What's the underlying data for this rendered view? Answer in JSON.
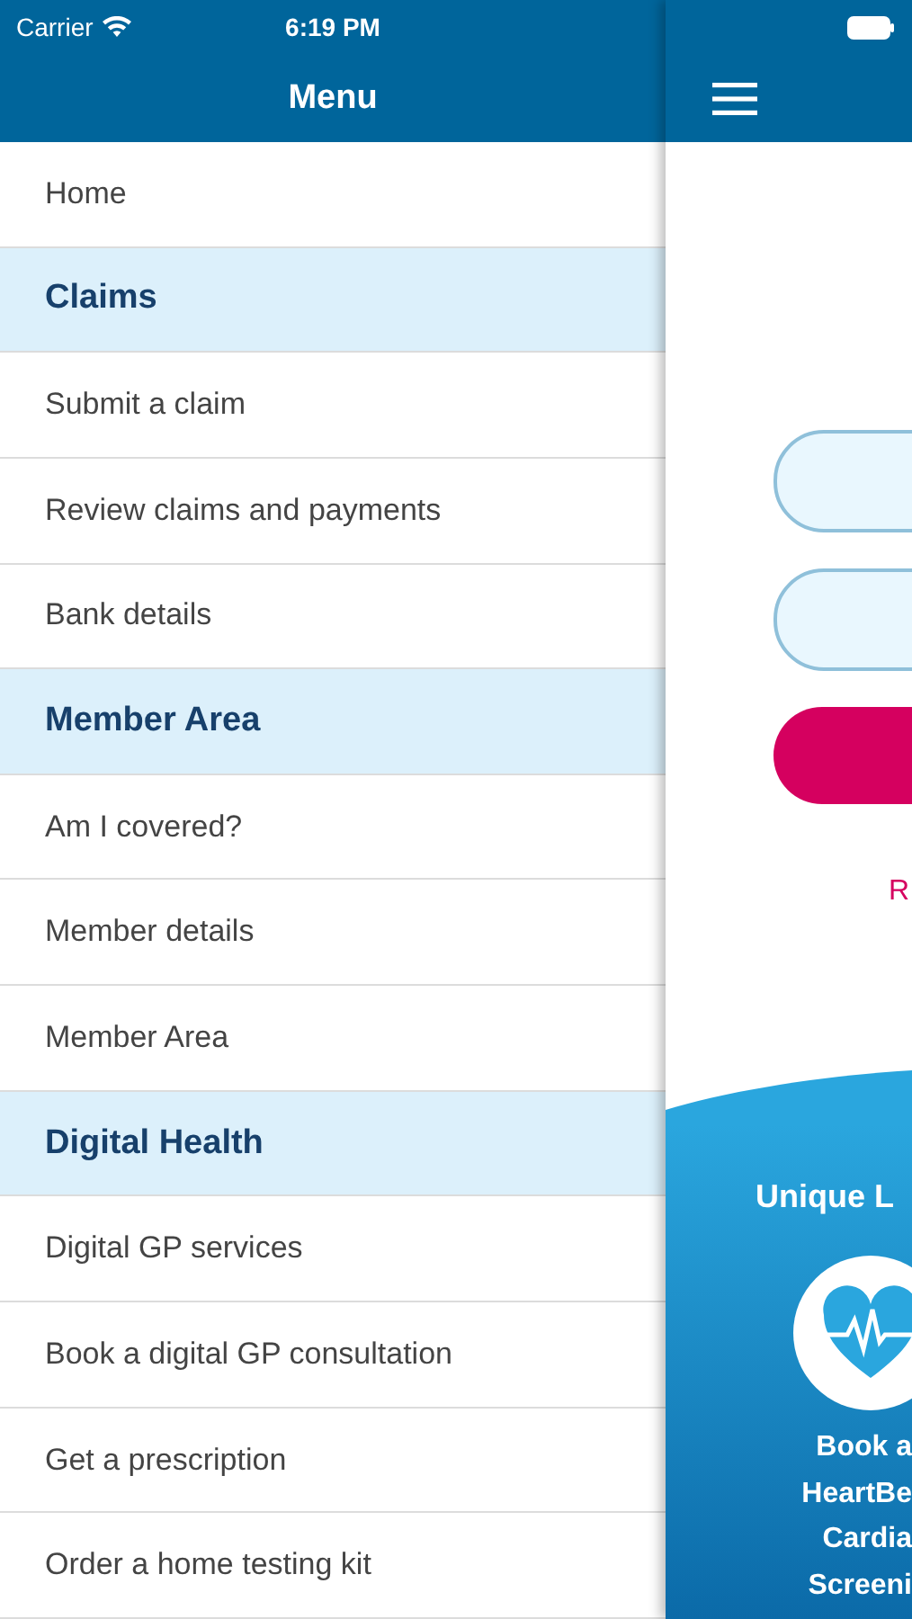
{
  "status_bar": {
    "carrier": "Carrier",
    "time": "6:19 PM"
  },
  "menu": {
    "title": "Menu",
    "items": [
      {
        "kind": "item",
        "label": "Home"
      },
      {
        "kind": "section",
        "label": "Claims"
      },
      {
        "kind": "item",
        "label": "Submit a claim"
      },
      {
        "kind": "item",
        "label": "Review claims and payments"
      },
      {
        "kind": "item",
        "label": "Bank details"
      },
      {
        "kind": "section",
        "label": "Member Area"
      },
      {
        "kind": "item",
        "label": "Am I covered?"
      },
      {
        "kind": "item",
        "label": "Member details"
      },
      {
        "kind": "item",
        "label": "Member Area"
      },
      {
        "kind": "section",
        "label": "Digital Health"
      },
      {
        "kind": "item",
        "label": "Digital GP services"
      },
      {
        "kind": "item",
        "label": "Book a digital GP consultation"
      },
      {
        "kind": "item",
        "label": "Get a prescription"
      },
      {
        "kind": "item",
        "label": "Order a home testing kit"
      }
    ]
  },
  "main": {
    "form": [
      {
        "kind": "field"
      },
      {
        "kind": "field"
      },
      {
        "kind": "button"
      }
    ],
    "link": "R",
    "promo": {
      "title": "Unique L",
      "lines": [
        "Book a",
        "HeartBe",
        "Cardia",
        "Screeni"
      ]
    }
  }
}
